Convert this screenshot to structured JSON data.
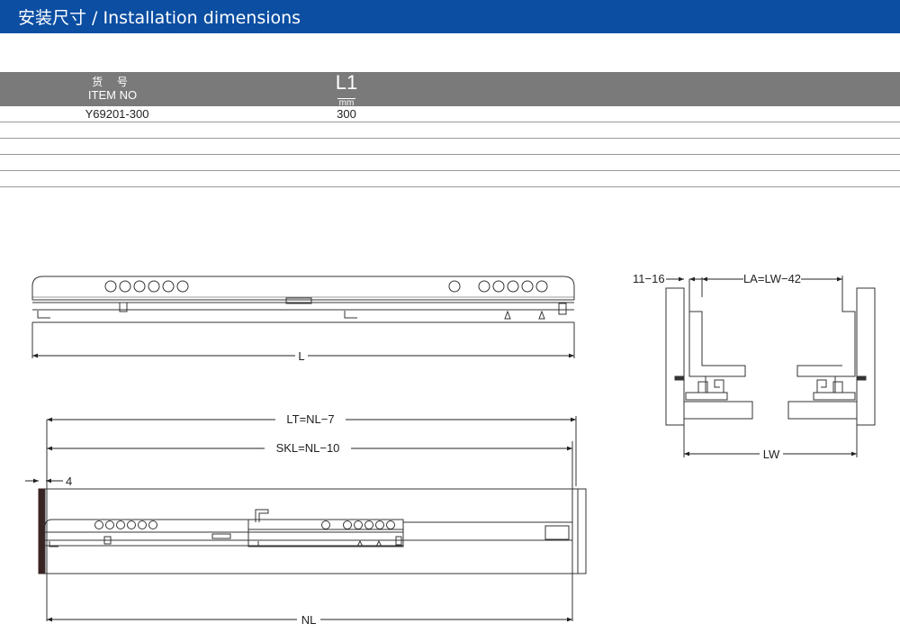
{
  "header": {
    "title": "安装尺寸 / Installation dimensions"
  },
  "table": {
    "col_item_cn": "货 号",
    "col_item_en": "ITEM NO",
    "col_l1": "L1",
    "col_l1_unit": "mm",
    "rows": [
      {
        "item": "Y69201-300",
        "l1": "300"
      },
      {
        "item": "",
        "l1": ""
      },
      {
        "item": "",
        "l1": ""
      },
      {
        "item": "",
        "l1": ""
      },
      {
        "item": "",
        "l1": ""
      }
    ]
  },
  "diagram": {
    "label_L": "L",
    "label_LT": "LT=NL−7",
    "label_SKL": "SKL=NL−10",
    "label_4": "4",
    "label_NL": "NL",
    "label_11_16": "11−16",
    "label_LA": "LA=LW−42",
    "label_LW": "LW"
  }
}
